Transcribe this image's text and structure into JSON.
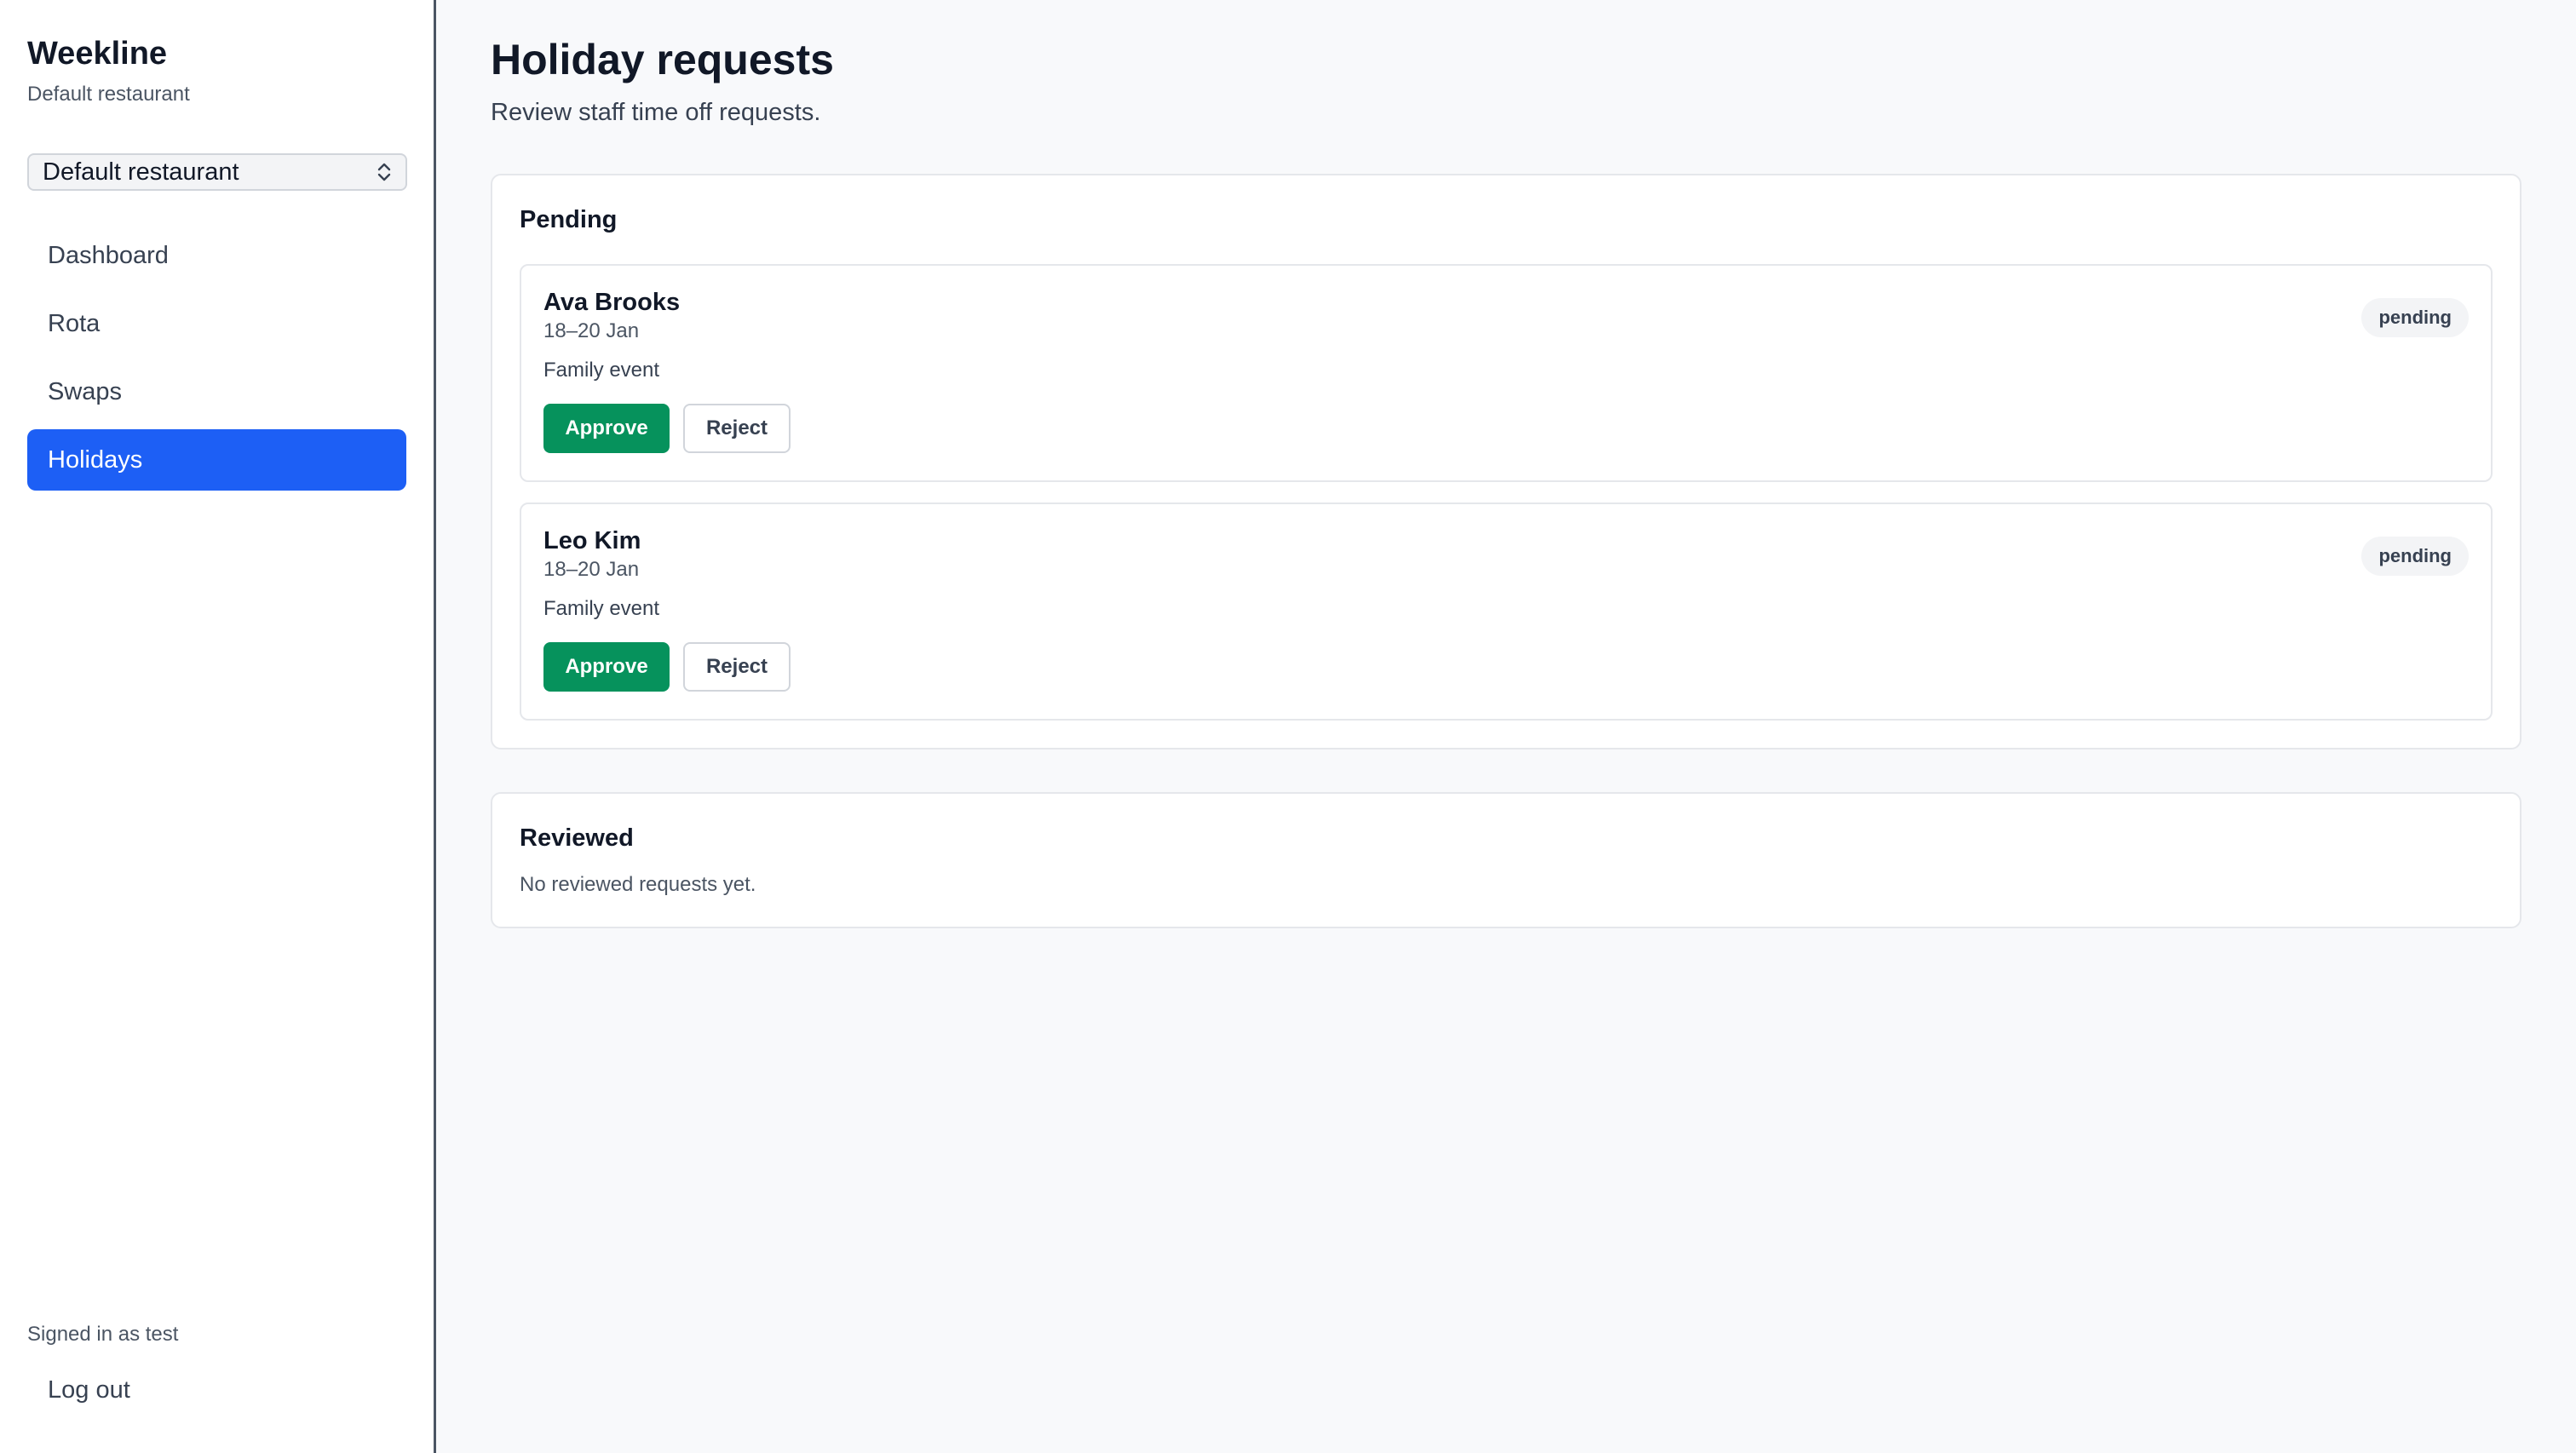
{
  "sidebar": {
    "brand": "Weekline",
    "brand_sub": "Default restaurant",
    "restaurant_select": {
      "value": "Default restaurant"
    },
    "nav": [
      {
        "label": "Dashboard",
        "active": false
      },
      {
        "label": "Rota",
        "active": false
      },
      {
        "label": "Swaps",
        "active": false
      },
      {
        "label": "Holidays",
        "active": true
      }
    ],
    "signed_in": "Signed in as test",
    "logout": "Log out"
  },
  "main": {
    "title": "Holiday requests",
    "subtitle": "Review staff time off requests.",
    "pending": {
      "title": "Pending",
      "requests": [
        {
          "name": "Ava Brooks",
          "dates": "18–20 Jan",
          "reason": "Family event",
          "status": "pending",
          "approve": "Approve",
          "reject": "Reject"
        },
        {
          "name": "Leo Kim",
          "dates": "18–20 Jan",
          "reason": "Family event",
          "status": "pending",
          "approve": "Approve",
          "reject": "Reject"
        }
      ]
    },
    "reviewed": {
      "title": "Reviewed",
      "empty": "No reviewed requests yet."
    }
  },
  "colors": {
    "accent": "#1d5ff5",
    "approve": "#06925c",
    "sidebar_border": "#4b5563"
  }
}
